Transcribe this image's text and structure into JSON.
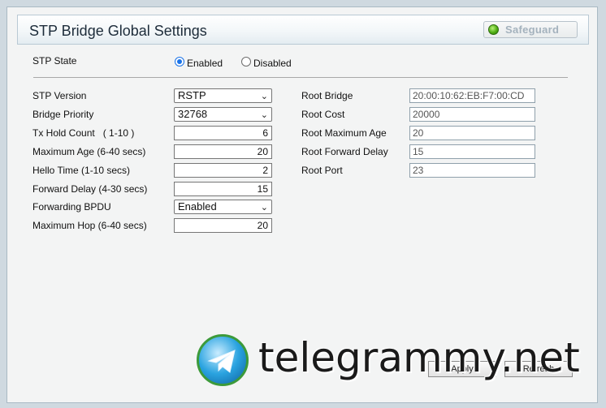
{
  "header": {
    "title": "STP Bridge Global Settings",
    "safeguard_label": "Safeguard"
  },
  "stp_state": {
    "label": "STP State",
    "options": [
      {
        "label": "Enabled",
        "checked": true
      },
      {
        "label": "Disabled",
        "checked": false
      }
    ]
  },
  "left_fields": [
    {
      "label": "STP Version",
      "type": "select",
      "value": "RSTP"
    },
    {
      "label": "Bridge Priority",
      "type": "select",
      "value": "32768"
    },
    {
      "label": "Tx Hold Count   ( 1-10 )",
      "type": "input",
      "value": "6"
    },
    {
      "label": "Maximum Age (6-40 secs)",
      "type": "input",
      "value": "20"
    },
    {
      "label": "Hello Time (1-10 secs)",
      "type": "input",
      "value": "2"
    },
    {
      "label": "Forward Delay (4-30 secs)",
      "type": "input",
      "value": "15"
    },
    {
      "label": "Forwarding BPDU",
      "type": "select",
      "value": "Enabled"
    },
    {
      "label": "Maximum Hop (6-40 secs)",
      "type": "input",
      "value": "20"
    }
  ],
  "right_fields": [
    {
      "label": "Root Bridge",
      "value": "20:00:10:62:EB:F7:00:CD"
    },
    {
      "label": "Root Cost",
      "value": "20000"
    },
    {
      "label": "Root Maximum Age",
      "value": "20"
    },
    {
      "label": "Root Forward Delay",
      "value": "15"
    },
    {
      "label": "Root Port",
      "value": "23"
    }
  ],
  "buttons": {
    "apply_label": "Apply",
    "refresh_label": "Refresh"
  },
  "watermark": {
    "text": "telegrammy.net"
  },
  "icons": {
    "safeguard": "status-led-icon",
    "select_arrow": "chevron-down-icon",
    "watermark_logo": "telegram-logo-icon"
  },
  "colors": {
    "safeguard_led": "#4fae12",
    "radio_accent": "#1a73e8",
    "page_bg": "#cfd9e0"
  }
}
